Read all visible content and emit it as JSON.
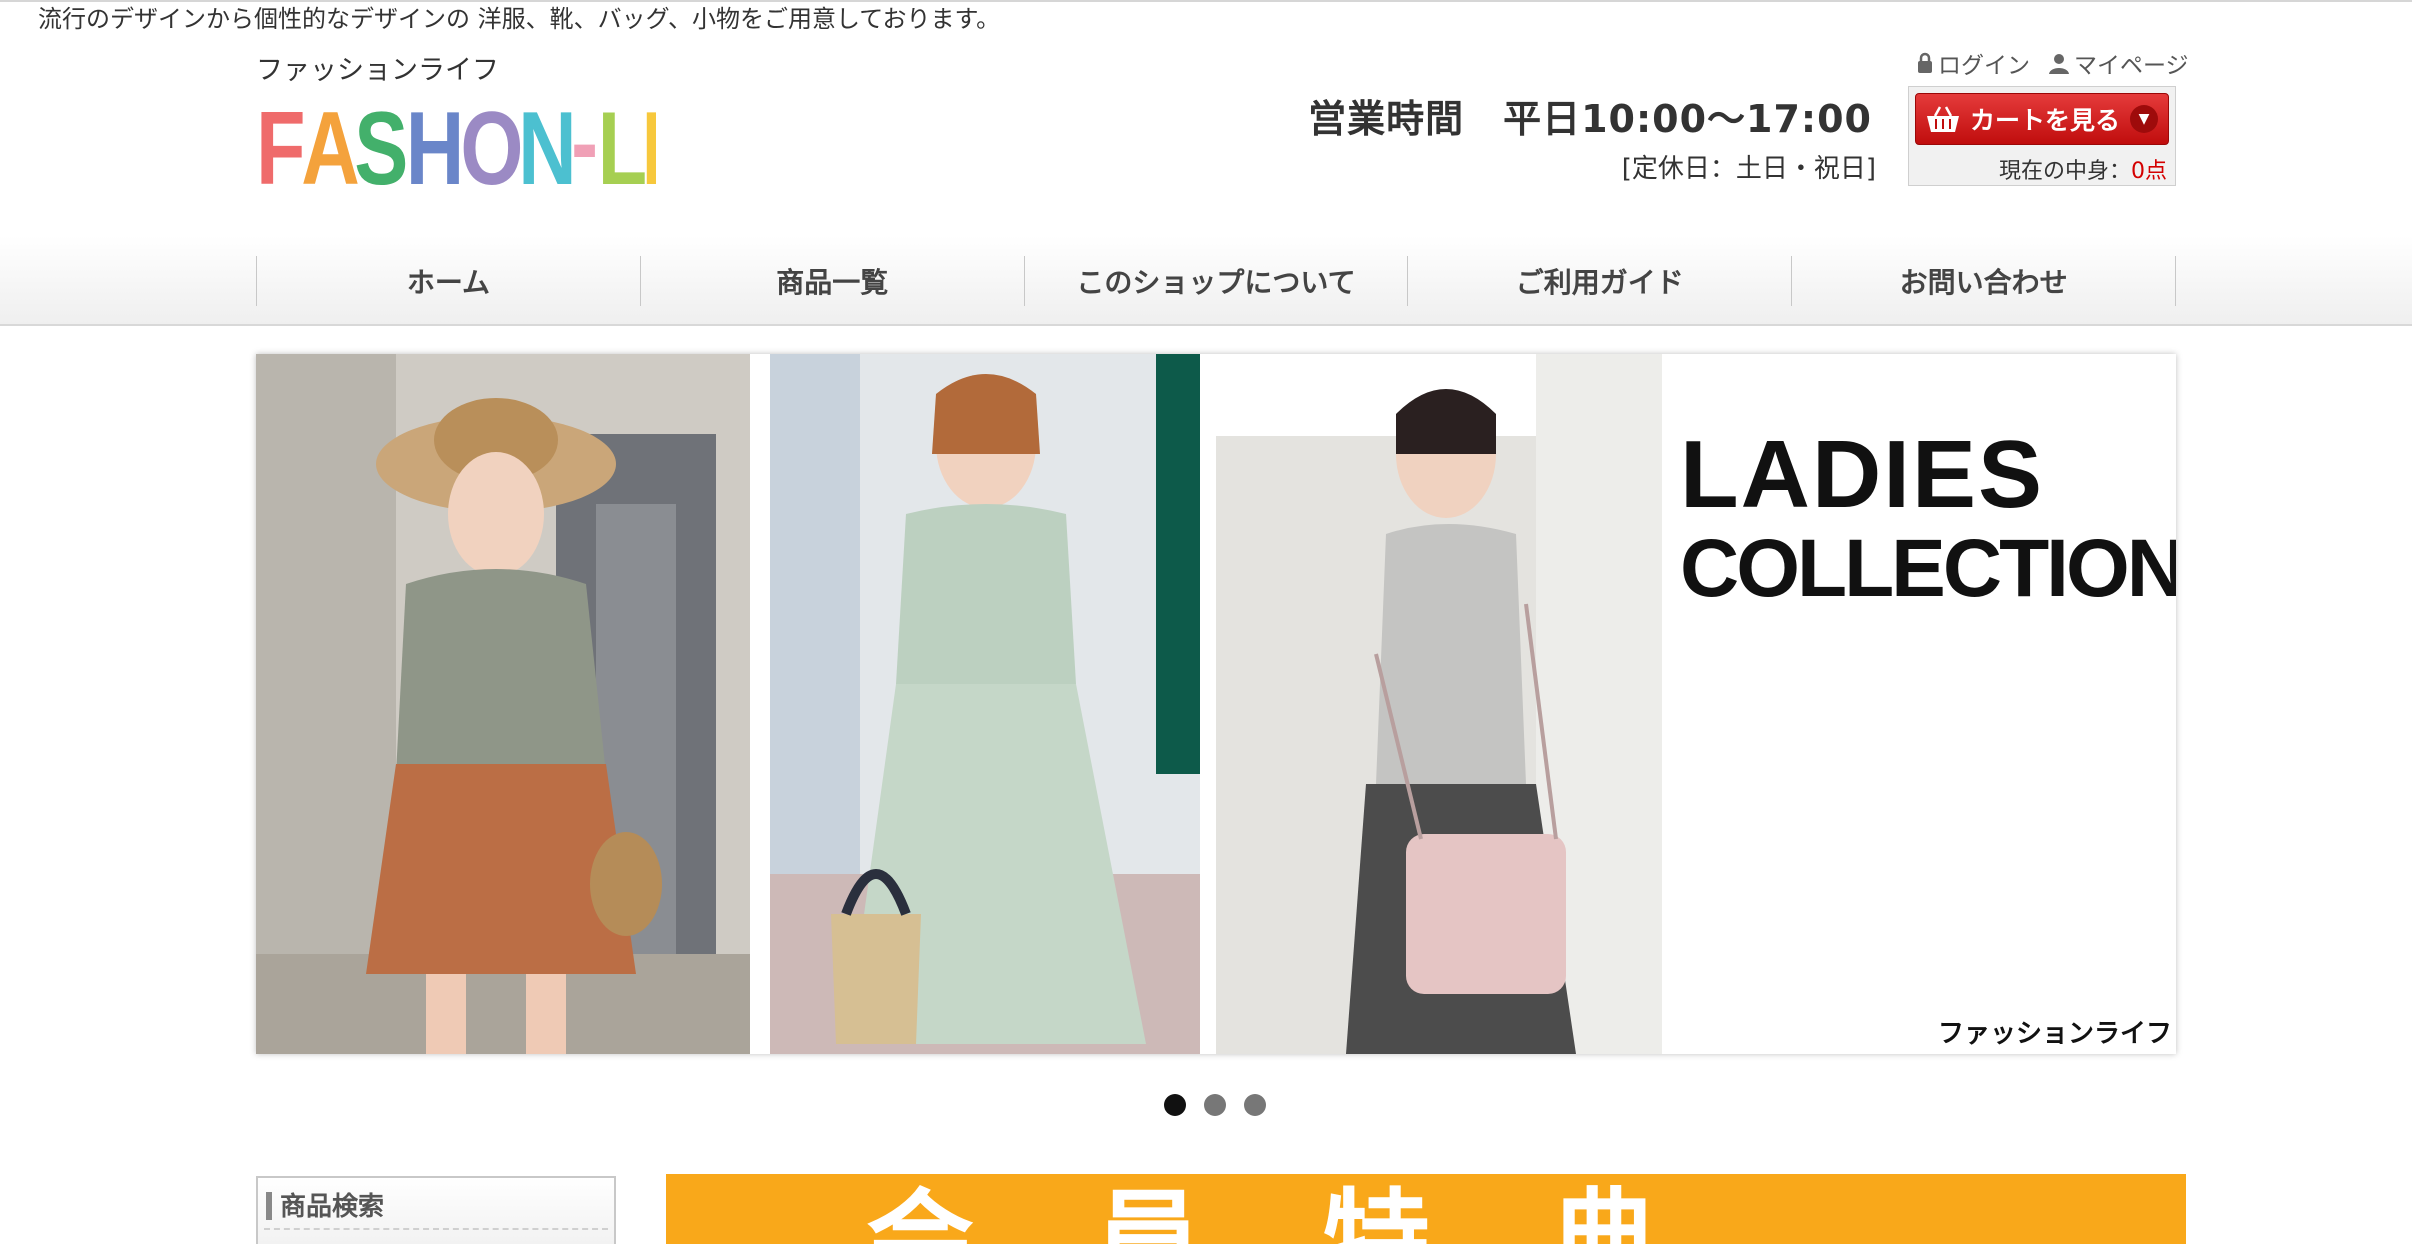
{
  "header": {
    "tagline": "流行のデザインから個性的なデザインの 洋服、靴、バッグ、小物をご用意しております。",
    "logo_sub": "ファッションライフ",
    "logo_text": "FASHON-LIFE",
    "hours": "営業時間　平日10:00〜17:00",
    "holiday": "[定休日：土日・祝日]"
  },
  "account": {
    "login": "ログイン",
    "mypage": "マイページ"
  },
  "cart": {
    "button": "カートを見る",
    "count_label": "現在の中身：",
    "count_value": "0点"
  },
  "nav": {
    "items": [
      "ホーム",
      "商品一覧",
      "このショップについて",
      "ご利用ガイド",
      "お問い合わせ"
    ]
  },
  "banner": {
    "line1": "LADIES",
    "line2": "COLLECTION",
    "signature": "ファッションライフ",
    "slide_count": 3,
    "active_slide": 1
  },
  "sidebar": {
    "search_title": "商品検索"
  },
  "promo": {
    "text": "会員特典"
  },
  "colors": {
    "cart_red": "#d41414",
    "promo_orange": "#f9a81a",
    "count_red": "#d40000"
  }
}
